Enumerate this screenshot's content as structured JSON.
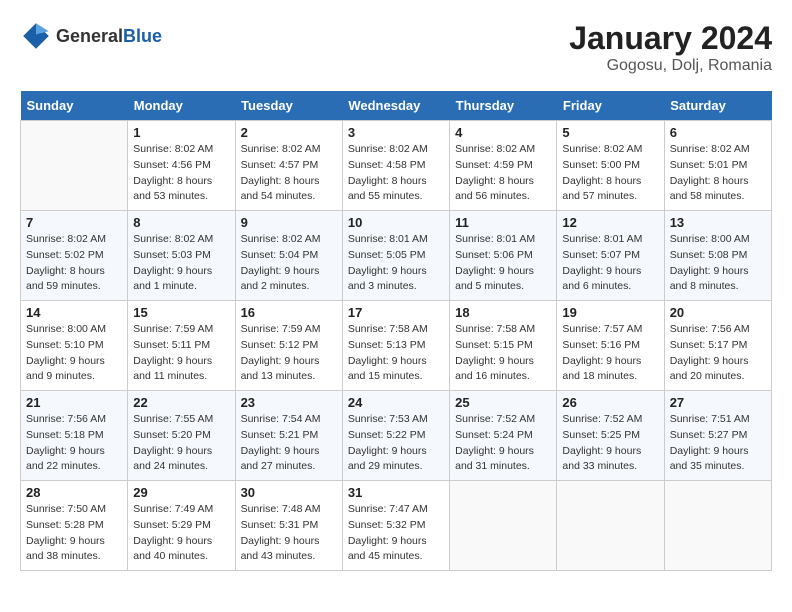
{
  "header": {
    "logo_general": "General",
    "logo_blue": "Blue",
    "month_year": "January 2024",
    "location": "Gogosu, Dolj, Romania"
  },
  "weekdays": [
    "Sunday",
    "Monday",
    "Tuesday",
    "Wednesday",
    "Thursday",
    "Friday",
    "Saturday"
  ],
  "weeks": [
    [
      {
        "day": "",
        "sunrise": "",
        "sunset": "",
        "daylight": ""
      },
      {
        "day": "1",
        "sunrise": "8:02 AM",
        "sunset": "4:56 PM",
        "daylight": "8 hours and 53 minutes."
      },
      {
        "day": "2",
        "sunrise": "8:02 AM",
        "sunset": "4:57 PM",
        "daylight": "8 hours and 54 minutes."
      },
      {
        "day": "3",
        "sunrise": "8:02 AM",
        "sunset": "4:58 PM",
        "daylight": "8 hours and 55 minutes."
      },
      {
        "day": "4",
        "sunrise": "8:02 AM",
        "sunset": "4:59 PM",
        "daylight": "8 hours and 56 minutes."
      },
      {
        "day": "5",
        "sunrise": "8:02 AM",
        "sunset": "5:00 PM",
        "daylight": "8 hours and 57 minutes."
      },
      {
        "day": "6",
        "sunrise": "8:02 AM",
        "sunset": "5:01 PM",
        "daylight": "8 hours and 58 minutes."
      }
    ],
    [
      {
        "day": "7",
        "sunrise": "8:02 AM",
        "sunset": "5:02 PM",
        "daylight": "8 hours and 59 minutes."
      },
      {
        "day": "8",
        "sunrise": "8:02 AM",
        "sunset": "5:03 PM",
        "daylight": "9 hours and 1 minute."
      },
      {
        "day": "9",
        "sunrise": "8:02 AM",
        "sunset": "5:04 PM",
        "daylight": "9 hours and 2 minutes."
      },
      {
        "day": "10",
        "sunrise": "8:01 AM",
        "sunset": "5:05 PM",
        "daylight": "9 hours and 3 minutes."
      },
      {
        "day": "11",
        "sunrise": "8:01 AM",
        "sunset": "5:06 PM",
        "daylight": "9 hours and 5 minutes."
      },
      {
        "day": "12",
        "sunrise": "8:01 AM",
        "sunset": "5:07 PM",
        "daylight": "9 hours and 6 minutes."
      },
      {
        "day": "13",
        "sunrise": "8:00 AM",
        "sunset": "5:08 PM",
        "daylight": "9 hours and 8 minutes."
      }
    ],
    [
      {
        "day": "14",
        "sunrise": "8:00 AM",
        "sunset": "5:10 PM",
        "daylight": "9 hours and 9 minutes."
      },
      {
        "day": "15",
        "sunrise": "7:59 AM",
        "sunset": "5:11 PM",
        "daylight": "9 hours and 11 minutes."
      },
      {
        "day": "16",
        "sunrise": "7:59 AM",
        "sunset": "5:12 PM",
        "daylight": "9 hours and 13 minutes."
      },
      {
        "day": "17",
        "sunrise": "7:58 AM",
        "sunset": "5:13 PM",
        "daylight": "9 hours and 15 minutes."
      },
      {
        "day": "18",
        "sunrise": "7:58 AM",
        "sunset": "5:15 PM",
        "daylight": "9 hours and 16 minutes."
      },
      {
        "day": "19",
        "sunrise": "7:57 AM",
        "sunset": "5:16 PM",
        "daylight": "9 hours and 18 minutes."
      },
      {
        "day": "20",
        "sunrise": "7:56 AM",
        "sunset": "5:17 PM",
        "daylight": "9 hours and 20 minutes."
      }
    ],
    [
      {
        "day": "21",
        "sunrise": "7:56 AM",
        "sunset": "5:18 PM",
        "daylight": "9 hours and 22 minutes."
      },
      {
        "day": "22",
        "sunrise": "7:55 AM",
        "sunset": "5:20 PM",
        "daylight": "9 hours and 24 minutes."
      },
      {
        "day": "23",
        "sunrise": "7:54 AM",
        "sunset": "5:21 PM",
        "daylight": "9 hours and 27 minutes."
      },
      {
        "day": "24",
        "sunrise": "7:53 AM",
        "sunset": "5:22 PM",
        "daylight": "9 hours and 29 minutes."
      },
      {
        "day": "25",
        "sunrise": "7:52 AM",
        "sunset": "5:24 PM",
        "daylight": "9 hours and 31 minutes."
      },
      {
        "day": "26",
        "sunrise": "7:52 AM",
        "sunset": "5:25 PM",
        "daylight": "9 hours and 33 minutes."
      },
      {
        "day": "27",
        "sunrise": "7:51 AM",
        "sunset": "5:27 PM",
        "daylight": "9 hours and 35 minutes."
      }
    ],
    [
      {
        "day": "28",
        "sunrise": "7:50 AM",
        "sunset": "5:28 PM",
        "daylight": "9 hours and 38 minutes."
      },
      {
        "day": "29",
        "sunrise": "7:49 AM",
        "sunset": "5:29 PM",
        "daylight": "9 hours and 40 minutes."
      },
      {
        "day": "30",
        "sunrise": "7:48 AM",
        "sunset": "5:31 PM",
        "daylight": "9 hours and 43 minutes."
      },
      {
        "day": "31",
        "sunrise": "7:47 AM",
        "sunset": "5:32 PM",
        "daylight": "9 hours and 45 minutes."
      },
      {
        "day": "",
        "sunrise": "",
        "sunset": "",
        "daylight": ""
      },
      {
        "day": "",
        "sunrise": "",
        "sunset": "",
        "daylight": ""
      },
      {
        "day": "",
        "sunrise": "",
        "sunset": "",
        "daylight": ""
      }
    ]
  ],
  "labels": {
    "sunrise_prefix": "Sunrise: ",
    "sunset_prefix": "Sunset: ",
    "daylight_prefix": "Daylight: "
  }
}
